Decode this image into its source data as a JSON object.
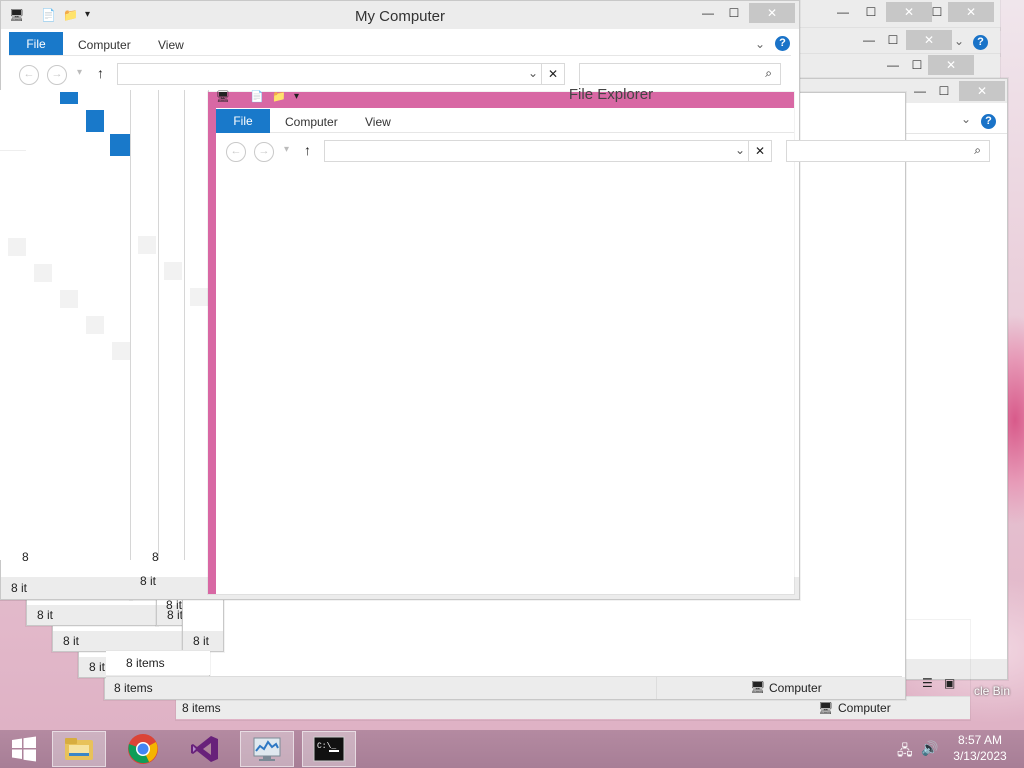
{
  "windows": {
    "back_title": "My Computer",
    "front_title": "File Explorer",
    "tabs": {
      "file": "File",
      "computer": "Computer",
      "view": "View"
    },
    "status_items": "8 items",
    "status_trunc": "8 it",
    "status_8": "8",
    "computer_label": "Computer",
    "recycle_bin_label": "cle Bin"
  },
  "taskbar": {
    "time": "8:57 AM",
    "date": "3/13/2023"
  },
  "colors": {
    "ribbon_blue": "#1979ca",
    "pink_title": "#d868a4",
    "taskbar": "#a77e96"
  }
}
